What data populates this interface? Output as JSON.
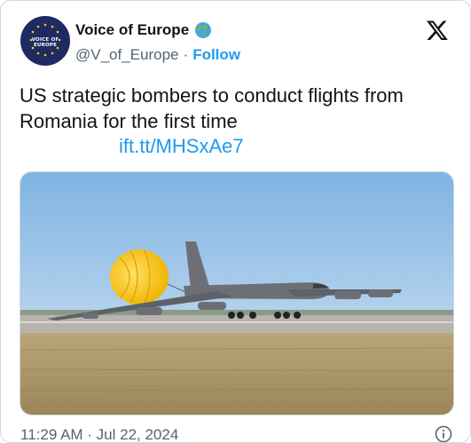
{
  "account": {
    "name": "Voice of Europe",
    "handle": "@V_of_Europe",
    "separator": "·",
    "follow_label": "Follow",
    "avatar_text": "VOICE OF EUROPE",
    "verified_icon": "globe-icon"
  },
  "tweet": {
    "text": "US strategic bombers to conduct flights from Romania for the first time",
    "link": "ift.tt/MHSxAe7"
  },
  "media": {
    "description_icon": "photo-bomber-parachute"
  },
  "footer": {
    "timestamp": "11:29 AM · Jul 22, 2024",
    "info_icon": "info-icon"
  },
  "colors": {
    "brand_blue": "#1d9bf0",
    "muted": "#536471",
    "avatar_bg": "#1d2a63"
  }
}
